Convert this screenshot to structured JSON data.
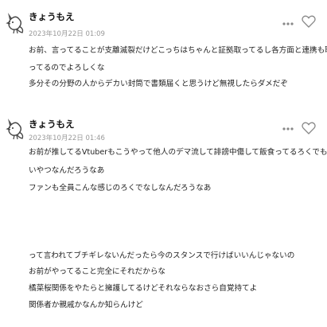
{
  "posts": [
    {
      "author": "きょうもえ",
      "timestamp": "2023年10月22日 01:09",
      "lines": [
        "お前、言ってることが支離滅裂だけどこっちはちゃんと証拠取ってるし各方面と連携も取",
        "ってるのでよろしくな",
        "多分その分野の人からデカい封筒で書類届くと思うけど無視したらダメだぞ"
      ]
    },
    {
      "author": "きょうもえ",
      "timestamp": "2023年10月22日 01:46",
      "lines": [
        "お前が推してるVtuberもこうやって他人のデマ流して誹謗中傷して飯食ってるろくでもな",
        "いやつなんだろうなあ",
        "ファンも全員こんな感じのろくでなしなんだろうなあ",
        "",
        "",
        "",
        "",
        "って言われてブチギレないんだったら今のスタンスで行けばいいんじゃないの",
        "お前がやってること完全にそれだからな",
        "橘菜桜関係をやたらと擁護してるけどそれならなおさら自覚持てよ",
        "関係者か親戚かなんか知らんけど"
      ]
    }
  ],
  "icons": {
    "avatar": "fox-avatar-icon",
    "more": "more-dots-icon",
    "like": "heart-icon"
  },
  "colors": {
    "text": "#222222",
    "timestamp": "#999999",
    "icon": "#888888"
  }
}
